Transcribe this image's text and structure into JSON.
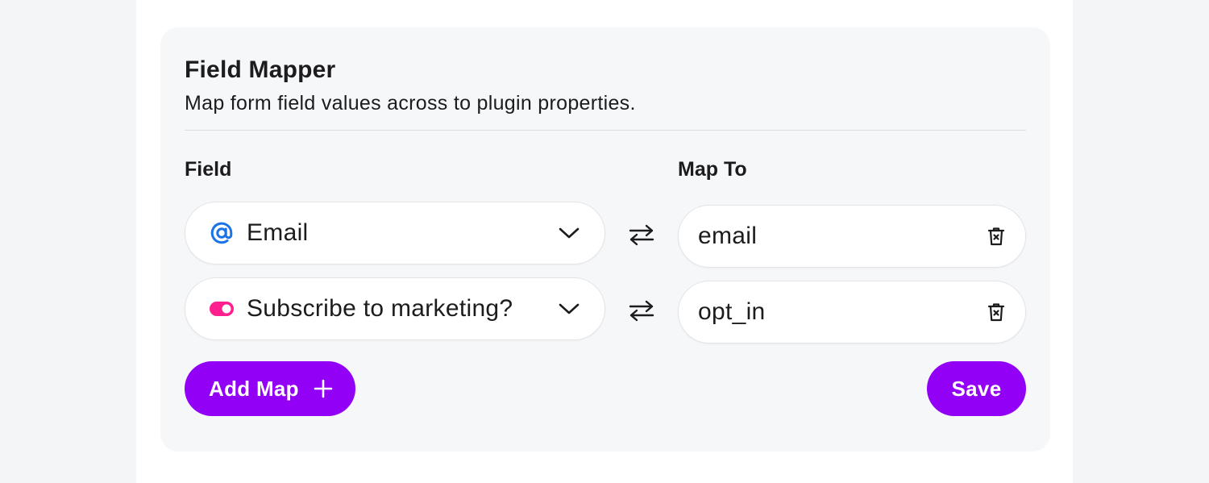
{
  "card": {
    "title": "Field Mapper",
    "subtitle": "Map form field values across to plugin properties."
  },
  "columns": {
    "field_label": "Field",
    "mapto_label": "Map To"
  },
  "mappings": [
    {
      "field": "Email",
      "field_icon": "at-sign-icon",
      "map_to": "email"
    },
    {
      "field": "Subscribe to marketing?",
      "field_icon": "toggle-icon",
      "map_to": "opt_in"
    }
  ],
  "buttons": {
    "add_map": "Add Map",
    "save": "Save"
  },
  "colors": {
    "accent": "#9200f5",
    "email_icon": "#1a73e8",
    "toggle_icon": "#ff1f8e"
  }
}
